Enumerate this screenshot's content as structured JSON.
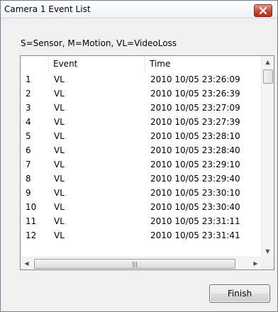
{
  "window": {
    "title": "Camera 1  Event List"
  },
  "legend": "S=Sensor, M=Motion, VL=VideoLoss",
  "table": {
    "columns": [
      "",
      "Event",
      "Time"
    ],
    "rows": [
      {
        "num": "1",
        "event": "VL",
        "time": "2010 10/05 23:26:09"
      },
      {
        "num": "2",
        "event": "VL",
        "time": "2010 10/05 23:26:39"
      },
      {
        "num": "3",
        "event": "VL",
        "time": "2010 10/05 23:27:09"
      },
      {
        "num": "4",
        "event": "VL",
        "time": "2010 10/05 23:27:39"
      },
      {
        "num": "5",
        "event": "VL",
        "time": "2010 10/05 23:28:10"
      },
      {
        "num": "6",
        "event": "VL",
        "time": "2010 10/05 23:28:40"
      },
      {
        "num": "7",
        "event": "VL",
        "time": "2010 10/05 23:29:10"
      },
      {
        "num": "8",
        "event": "VL",
        "time": "2010 10/05 23:29:40"
      },
      {
        "num": "9",
        "event": "VL",
        "time": "2010 10/05 23:30:10"
      },
      {
        "num": "10",
        "event": "VL",
        "time": "2010 10/05 23:30:40"
      },
      {
        "num": "11",
        "event": "VL",
        "time": "2010 10/05 23:31:11"
      },
      {
        "num": "12",
        "event": "VL",
        "time": "2010 10/05 23:31:41"
      }
    ]
  },
  "icons": {
    "close": "close-icon",
    "scroll_up": "up-arrow-icon",
    "scroll_down": "down-arrow-icon",
    "scroll_left": "left-arrow-icon",
    "scroll_right": "right-arrow-icon",
    "grip": "grip-icon"
  },
  "buttons": {
    "finish": "Finish"
  },
  "colors": {
    "close_button": "#c24b38",
    "border": "#828790"
  }
}
